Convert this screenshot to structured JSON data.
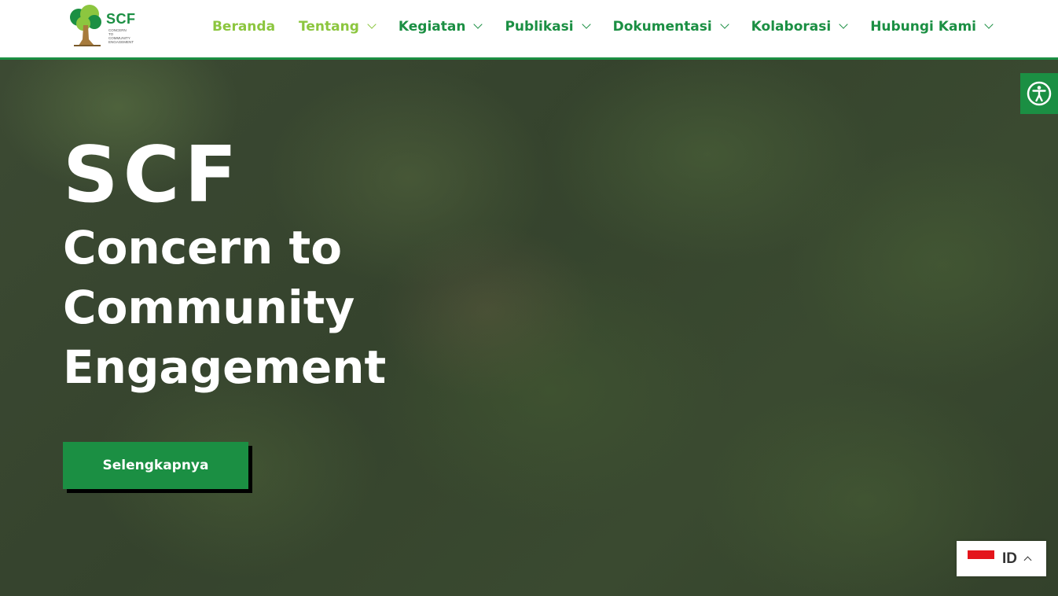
{
  "brand": {
    "logo_text": "SCF",
    "logo_subtext": [
      "CONCERN",
      "TO",
      "COMMUNITY",
      "ENGAGEMENT"
    ],
    "primary_color": "#1b8f43",
    "accent_color": "#8cc63f"
  },
  "nav": {
    "items": [
      {
        "label": "Beranda",
        "dropdown": false,
        "active": true
      },
      {
        "label": "Tentang",
        "dropdown": true
      },
      {
        "label": "Kegiatan",
        "dropdown": true
      },
      {
        "label": "Publikasi",
        "dropdown": true
      },
      {
        "label": "Dokumentasi",
        "dropdown": true
      },
      {
        "label": "Kolaborasi",
        "dropdown": true
      },
      {
        "label": "Hubungi Kami",
        "dropdown": true
      }
    ]
  },
  "hero": {
    "title": "SCF",
    "subtitle": "Concern to Community Engagement",
    "cta_label": "Selengkapnya"
  },
  "accessibility": {
    "icon": "accessibility-icon"
  },
  "language": {
    "code": "ID",
    "flag": "indonesia-flag-icon"
  }
}
